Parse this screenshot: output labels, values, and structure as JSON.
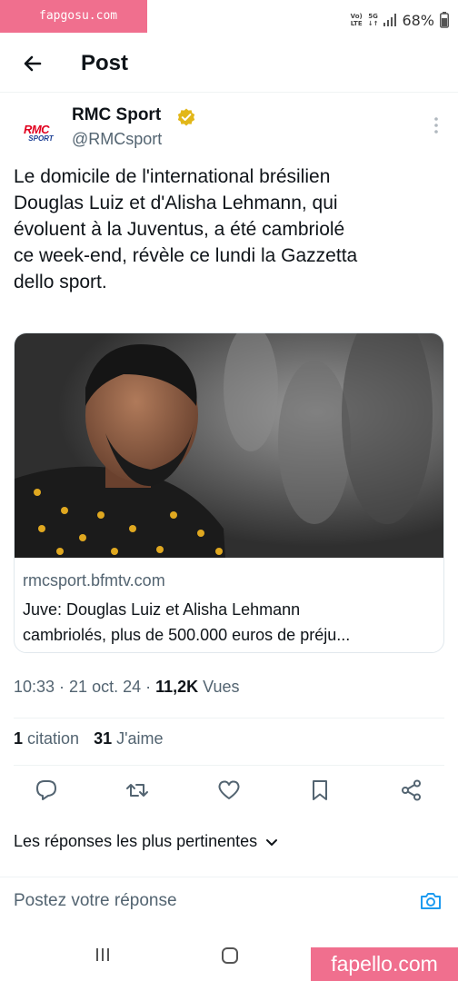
{
  "watermark_top": "fapgosu.com",
  "watermark_bottom": "fapello.com",
  "status": {
    "network_top": "Vo)",
    "network_bottom": "LTE",
    "gen": "5G",
    "battery": "68%"
  },
  "header": {
    "title": "Post"
  },
  "author": {
    "avatar_line1": "RMC",
    "avatar_line2": "SPORT",
    "name": "RMC Sport",
    "handle": "@RMCsport"
  },
  "tweet": {
    "text": "Le domicile de l'international brésilien\nDouglas Luiz et d'Alisha Lehmann, qui\névoluent à la Juventus, a été cambriolé\nce week-end, révèle ce lundi la Gazzetta\ndello sport."
  },
  "card": {
    "domain": "rmcsport.bfmtv.com",
    "title": "Juve: Douglas Luiz et Alisha Lehmann\ncambriolés, plus de 500.000 euros de préju..."
  },
  "meta": {
    "time": "10:33",
    "sep1": " · ",
    "date": "21 oct. 24",
    "sep2": " · ",
    "views_count": "11,2K",
    "views_label": " Vues"
  },
  "stats": {
    "quotes_count": "1",
    "quotes_label": " citation",
    "likes_count": "31",
    "likes_label": " J'aime"
  },
  "sort": {
    "label": "Les réponses les plus pertinentes"
  },
  "reply": {
    "placeholder": "Postez votre réponse"
  },
  "colors": {
    "accent": "#1d9bf0",
    "watermark": "#f06f8e",
    "verified": "#e2b719",
    "rmc_red": "#e1001e",
    "rmc_blue": "#1c3f94"
  }
}
